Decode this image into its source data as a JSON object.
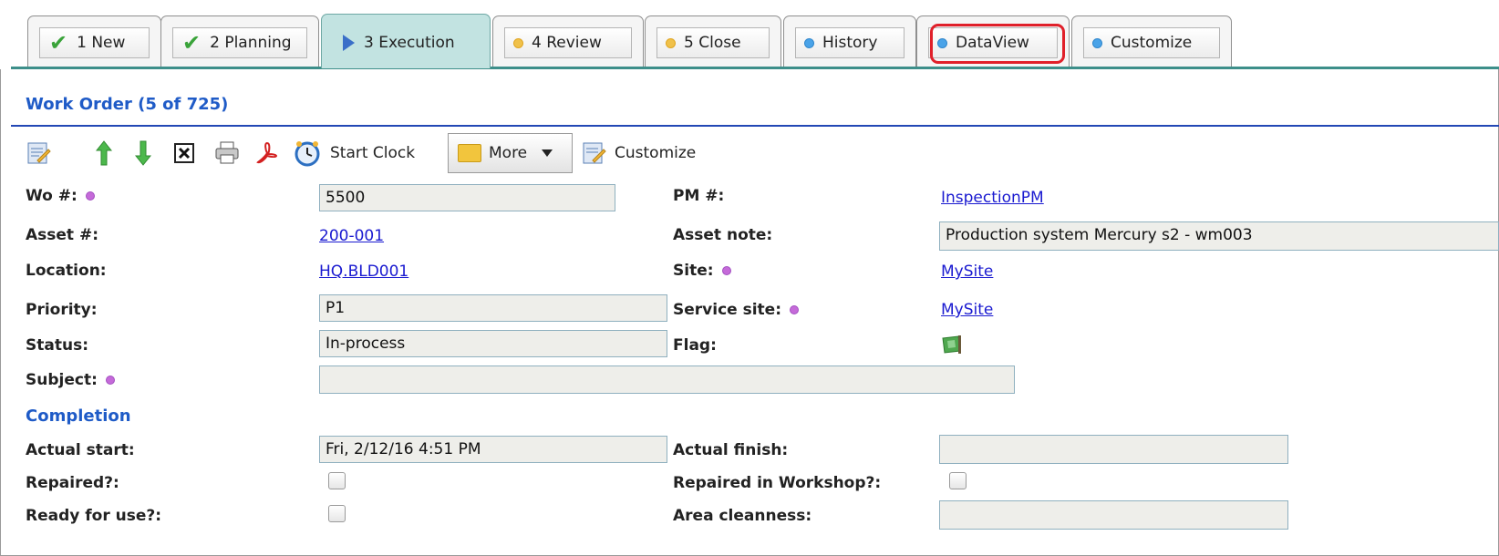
{
  "tabs": [
    {
      "label": "1 New",
      "icon": "check-icon"
    },
    {
      "label": "2 Planning",
      "icon": "check-icon"
    },
    {
      "label": "3 Execution",
      "icon": "play-icon",
      "active": true
    },
    {
      "label": "4 Review",
      "icon": "yellow-dot-icon"
    },
    {
      "label": "5 Close",
      "icon": "yellow-dot-icon"
    },
    {
      "label": "History",
      "icon": "blue-dot-icon"
    },
    {
      "label": "DataView",
      "icon": "blue-dot-icon",
      "highlighted": true
    },
    {
      "label": "Customize",
      "icon": "blue-dot-icon"
    }
  ],
  "header": {
    "title": "Work Order (5 of 725)"
  },
  "toolbar": {
    "start_clock_label": "Start Clock",
    "more_label": "More",
    "customize_label": "Customize"
  },
  "form": {
    "wo_label": "Wo #:",
    "wo_value": "5500",
    "pm_label": "PM #:",
    "pm_value": "InspectionPM",
    "asset_label": "Asset #:",
    "asset_value": "200-001",
    "asset_note_label": "Asset note:",
    "asset_note_value": "Production system Mercury s2 - wm003",
    "location_label": "Location:",
    "location_value": "HQ.BLD001",
    "site_label": "Site:",
    "site_value": "MySite",
    "priority_label": "Priority:",
    "priority_value": "P1",
    "service_site_label": "Service site:",
    "service_site_value": "MySite",
    "status_label": "Status:",
    "status_value": "In-process",
    "flag_label": "Flag:",
    "subject_label": "Subject:",
    "subject_value": ""
  },
  "completion": {
    "section_title": "Completion",
    "actual_start_label": "Actual start:",
    "actual_start_value": "Fri, 2/12/16 4:51 PM",
    "actual_finish_label": "Actual finish:",
    "actual_finish_value": "",
    "repaired_label": "Repaired?:",
    "repaired_workshop_label": "Repaired in Workshop?:",
    "ready_label": "Ready for use?:",
    "area_clean_label": "Area cleanness:",
    "area_clean_value": ""
  },
  "colors": {
    "accent": "#1f5bc7",
    "tab_active": "#c2e3e1",
    "highlight": "#e0202a"
  }
}
